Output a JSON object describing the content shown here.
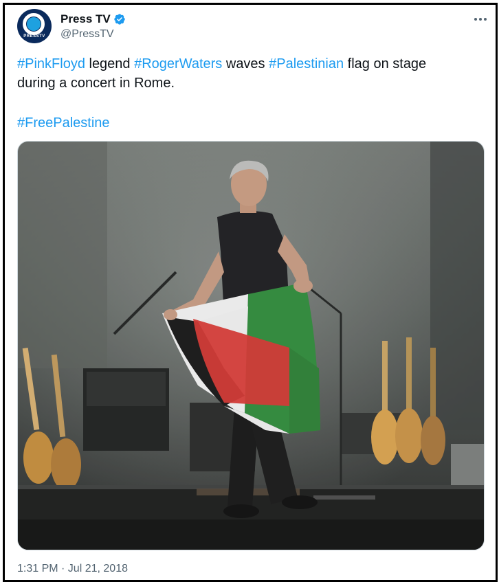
{
  "author": {
    "display_name": "Press TV",
    "handle": "@PressTV",
    "avatar_text": "PRESSTV",
    "verified": true,
    "verified_color": "#1d9bf0"
  },
  "more_label": "•••",
  "tweet": {
    "hashtags": {
      "pink_floyd": "#PinkFloyd",
      "roger_waters": "#RogerWaters",
      "palestinian": "#Palestinian",
      "free_palestine": "#FreePalestine"
    },
    "text_parts": {
      "legend": " legend ",
      "waves": " waves ",
      "rest_line1": " flag on stage",
      "line2": "during a concert in Rome."
    }
  },
  "media": {
    "icon": "photo-image"
  },
  "timestamp": "1:31 PM · Jul 21, 2018",
  "colors": {
    "link": "#1d9bf0",
    "text": "#0f1419",
    "secondary": "#536471"
  }
}
